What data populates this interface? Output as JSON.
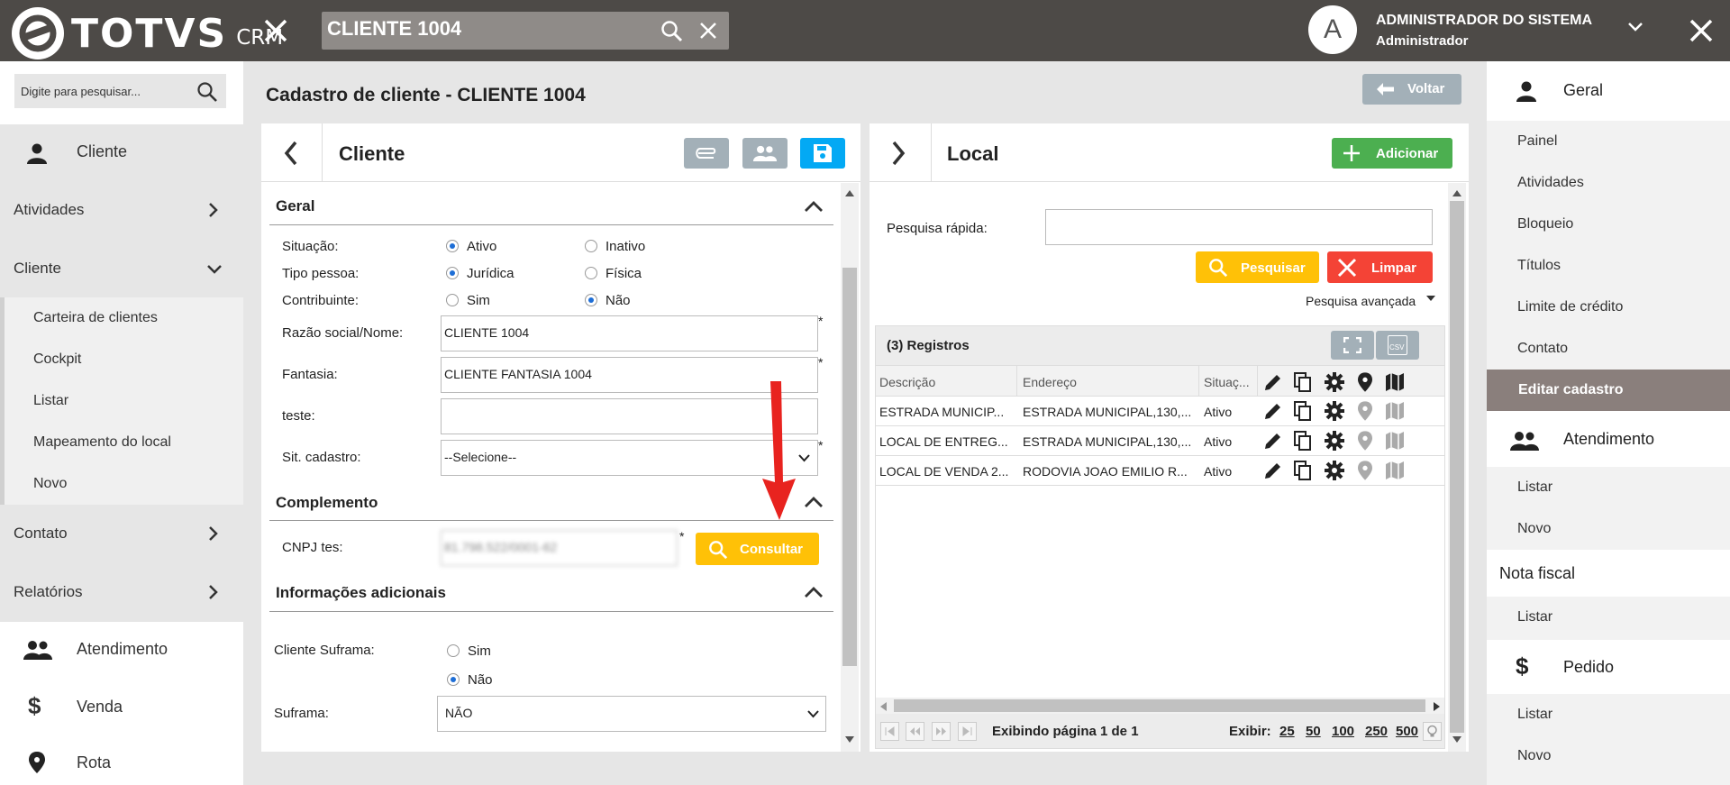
{
  "brand": {
    "name": "TOTVS",
    "suffix": "CRM"
  },
  "header": {
    "search_value": "CLIENTE 1004",
    "user_initial": "A",
    "user_name": "ADMINISTRADOR DO SISTEMA",
    "user_role": "Administrador"
  },
  "left_sidebar": {
    "search_placeholder": "Digite para pesquisar...",
    "cliente_header": "Cliente",
    "atividades": "Atividades",
    "cliente_group": "Cliente",
    "cliente_items": [
      "Carteira de clientes",
      "Cockpit",
      "Listar",
      "Mapeamento do local",
      "Novo"
    ],
    "contato": "Contato",
    "relatorios": "Relatórios",
    "atendimento": "Atendimento",
    "venda": "Venda",
    "rota": "Rota"
  },
  "page": {
    "title": "Cadastro de cliente - CLIENTE 1004",
    "back_label": "Voltar"
  },
  "cliente_panel": {
    "title": "Cliente",
    "geral": {
      "title": "Geral",
      "situacao_label": "Situação:",
      "situacao_options": [
        "Ativo",
        "Inativo"
      ],
      "situacao_selected": "Ativo",
      "tipo_label": "Tipo pessoa:",
      "tipo_options": [
        "Jurídica",
        "Física"
      ],
      "tipo_selected": "Jurídica",
      "contribuinte_label": "Contribuinte:",
      "contribuinte_options": [
        "Sim",
        "Não"
      ],
      "contribuinte_selected": "Não",
      "razao_label": "Razão social/Nome:",
      "razao_value": "CLIENTE 1004",
      "fantasia_label": "Fantasia:",
      "fantasia_value": "CLIENTE FANTASIA 1004",
      "teste_label": "teste:",
      "teste_value": "",
      "sit_label": "Sit. cadastro:",
      "sit_value": "--Selecione--",
      "required_mark": "*"
    },
    "complemento": {
      "title": "Complemento",
      "cnpj_label": "CNPJ tes:",
      "cnpj_value": "81.798.522/0001-62",
      "consultar_label": "Consultar"
    },
    "info": {
      "title": "Informações adicionais",
      "suframa_cliente_label": "Cliente Suframa:",
      "suframa_options": [
        "Sim",
        "Não"
      ],
      "suframa_selected": "Não",
      "suframa_label": "Suframa:",
      "suframa_value": "NÃO"
    }
  },
  "local_panel": {
    "title": "Local",
    "add_label": "Adicionar",
    "quick_search_label": "Pesquisa rápida:",
    "search_label": "Pesquisar",
    "clear_label": "Limpar",
    "advanced_label": "Pesquisa avançada",
    "records_label": "(3) Registros",
    "csv_label": "CSV",
    "columns": [
      "Descrição",
      "Endereço",
      "Situaç..."
    ],
    "rows": [
      {
        "descricao": "ESTRADA MUNICIP...",
        "endereco": "ESTRADA MUNICIPAL,130,...",
        "situacao": "Ativo"
      },
      {
        "descricao": "LOCAL DE ENTREG...",
        "endereco": "ESTRADA MUNICIPAL,130,...",
        "situacao": "Ativo"
      },
      {
        "descricao": "LOCAL DE VENDA 2...",
        "endereco": "RODOVIA JOAO EMILIO R...",
        "situacao": "Ativo"
      }
    ],
    "paging_label": "Exibindo página 1 de 1",
    "show_label": "Exibir:",
    "page_sizes": [
      "25",
      "50",
      "100",
      "250",
      "500"
    ]
  },
  "right_sidebar": {
    "geral": "Geral",
    "geral_items": [
      "Painel",
      "Atividades",
      "Bloqueio",
      "Títulos",
      "Limite de crédito",
      "Contato"
    ],
    "selected_item": "Editar cadastro",
    "atendimento": "Atendimento",
    "atendimento_items": [
      "Listar",
      "Novo"
    ],
    "nota_fiscal": "Nota fiscal",
    "nota_items": [
      "Listar"
    ],
    "pedido": "Pedido",
    "pedido_items": [
      "Listar",
      "Novo"
    ]
  },
  "colors": {
    "topbar": "#4d4a47",
    "save_blue": "#03a9f4",
    "add_green": "#4caf50",
    "search_yellow": "#ffc107",
    "clear_red": "#f44336",
    "selected_item_bg": "#8a7f7c",
    "annotation_red": "#e8231f"
  }
}
